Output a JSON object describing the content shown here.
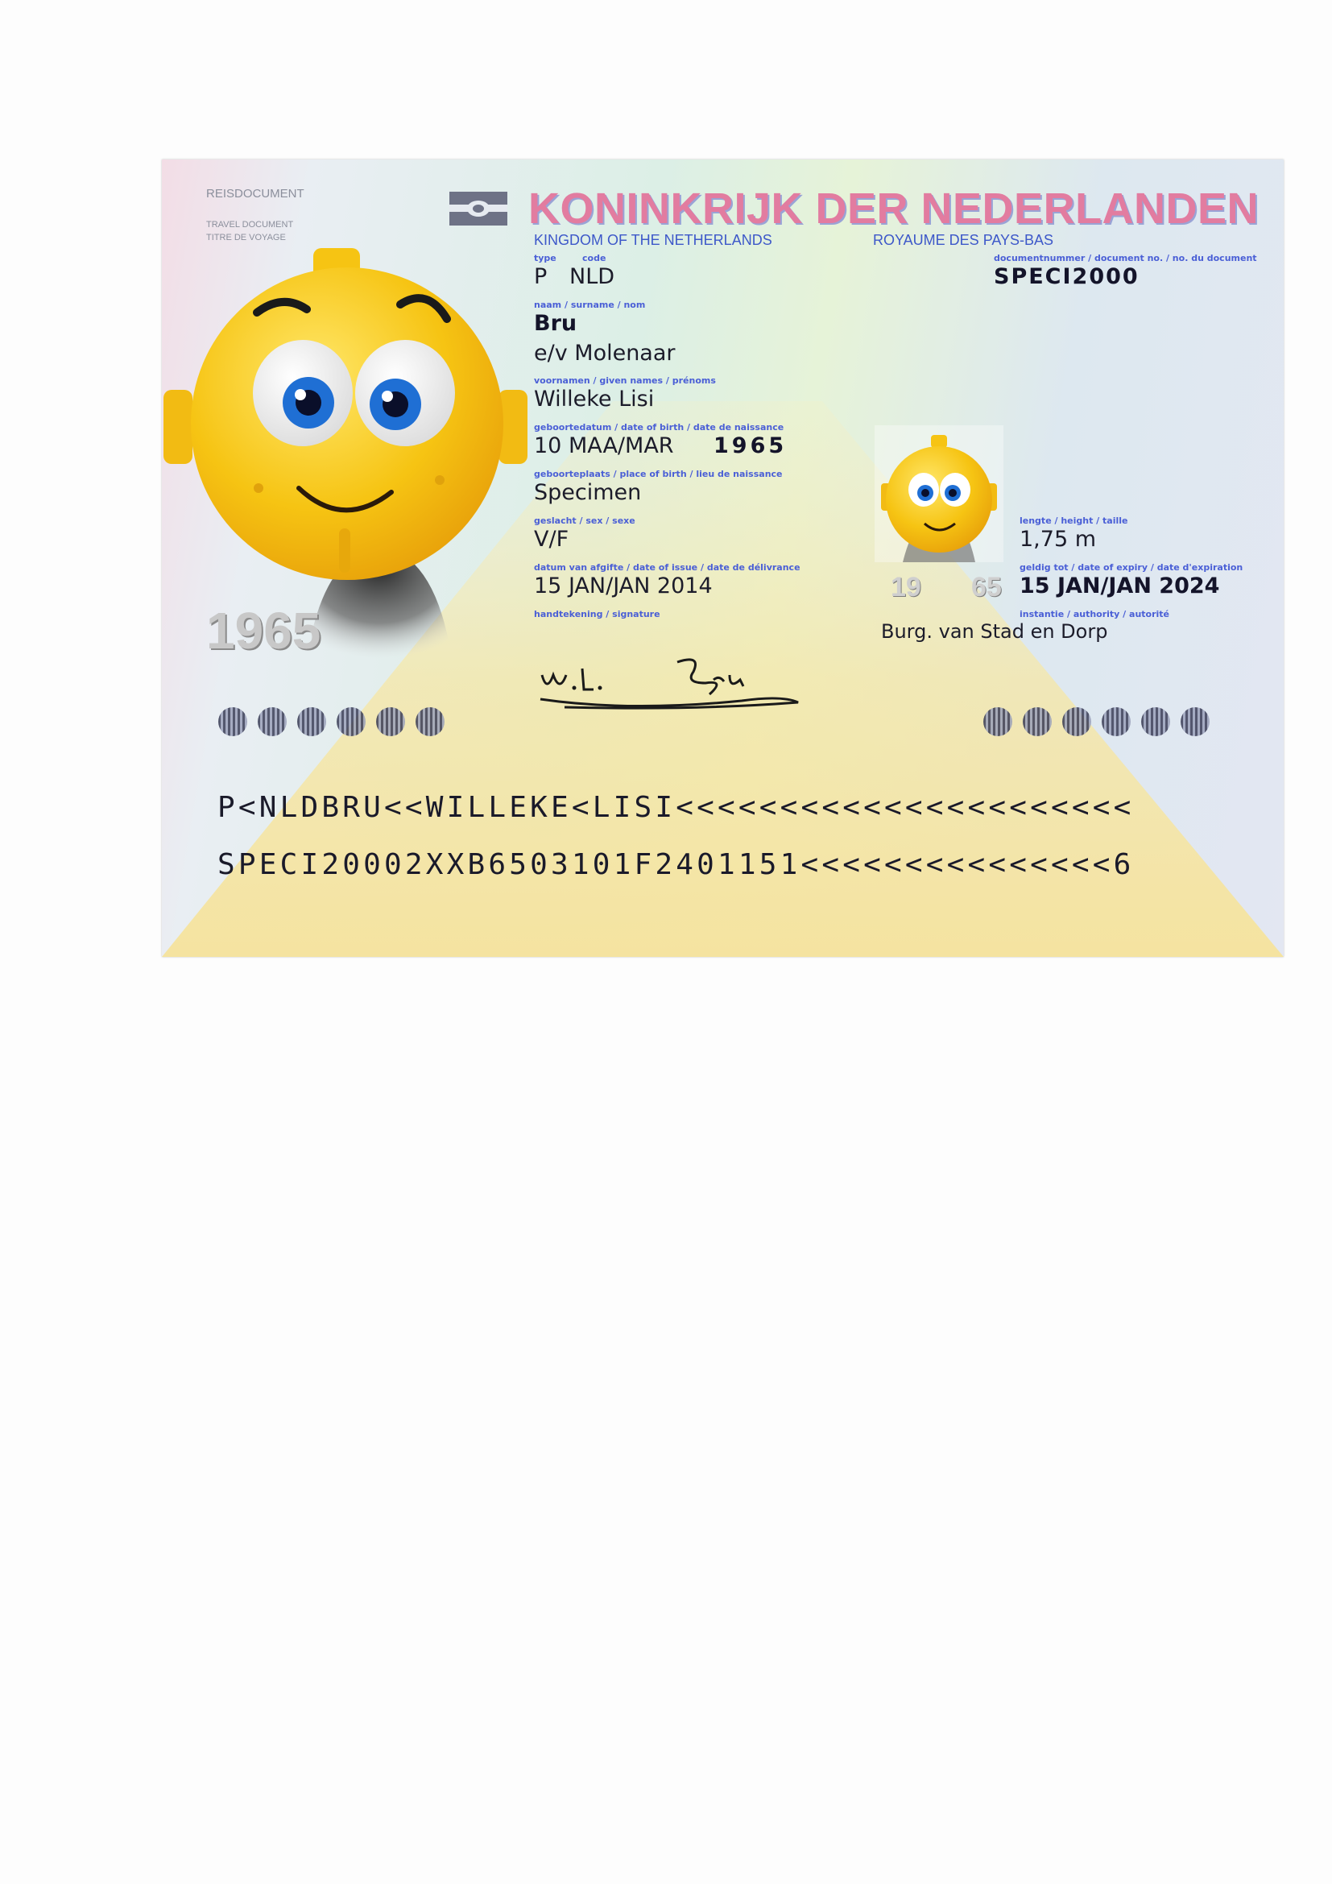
{
  "header": {
    "reisdocument": "REISDOCUMENT",
    "travel_document": "TRAVEL DOCUMENT",
    "titre_de_voyage": "TITRE DE VOYAGE",
    "country_title": "KONINKRIJK DER NEDERLANDEN",
    "kingdom_en": "KINGDOM OF THE NETHERLANDS",
    "kingdom_fr": "ROYAUME DES PAYS-BAS"
  },
  "fields": {
    "type_label": "type",
    "code_label": "code",
    "type_value": "P",
    "code_value": "NLD",
    "docnum_label": "documentnummer / document no. / no. du document",
    "docnum_value": "SPECI2000",
    "surname_label": "naam / surname / nom",
    "surname_value": "Bru",
    "surname_line2": "e/v Molenaar",
    "given_label": "voornamen / given names / prénoms",
    "given_value": "Willeke Lisi",
    "dob_label": "geboortedatum / date of birth / date de naissance",
    "dob_value": "10 MAA/MAR",
    "dob_year": "1965",
    "pob_label": "geboorteplaats / place of birth / lieu de naissance",
    "pob_value": "Specimen",
    "sex_label": "geslacht / sex / sexe",
    "sex_value": "V/F",
    "issue_label": "datum van afgifte / date of issue / date de délivrance",
    "issue_value": "15 JAN/JAN 2014",
    "sig_label": "handtekening / signature",
    "height_label": "lengte / height / taille",
    "height_value": "1,75 m",
    "expiry_label": "geldig tot / date of expiry / date d'expiration",
    "expiry_value": "15 JAN/JAN 2024",
    "authority_label": "instantie / authority / autorité",
    "authority_value": "Burg. van Stad en Dorp"
  },
  "photo": {
    "year_ghost": "1965",
    "small_year_left": "19",
    "small_year_right": "65"
  },
  "signature": {
    "text": "W.L. Bru"
  },
  "mrz": {
    "line1": "P<NLDBRU<<WILLEKE<LISI<<<<<<<<<<<<<<<<<<<<<<",
    "line2": "SPECI20002XXB6503101F2401151<<<<<<<<<<<<<<<6"
  },
  "colors": {
    "label_blue": "#4a5fd6",
    "title_pink": "#e05f8a",
    "title_blue": "#7a88c9",
    "emoji_yellow": "#f4c10f"
  }
}
